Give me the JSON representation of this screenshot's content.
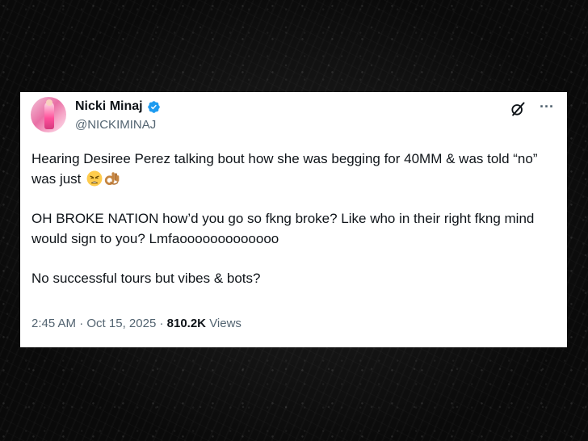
{
  "tweet": {
    "author": {
      "name": "Nicki Minaj",
      "handle": "@NICKIMINAJ",
      "verified": true,
      "verified_color": "#1d9bf0"
    },
    "text_lines": [
      "Hearing Desiree Perez talking bout how she was begging for 40MM & was told “no” was just",
      "OH BROKE NATION how’d you go so fkng broke? Like who in their right fkng mind would sign to you? Lmfaooooooooooooo",
      "No successful tours but vibes & bots?"
    ],
    "emojis": [
      "weary-face",
      "ok-hand"
    ],
    "icons": [
      "grok-icon",
      "more-icon"
    ],
    "time": "2:45 AM",
    "separator": "·",
    "date": "Oct 15, 2025",
    "views_count": "810.2K",
    "views_label": "Views"
  }
}
